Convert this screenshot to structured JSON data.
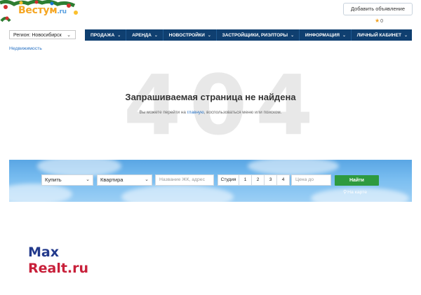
{
  "header": {
    "logo_text": "Вестум",
    "logo_suffix": ".ru",
    "add_ad_label": "Добавить объявление",
    "favorites_count": "0"
  },
  "nav": {
    "region_label": "Регион: Новосибирск",
    "items": [
      {
        "label": "ПРОДАЖА"
      },
      {
        "label": "АРЕНДА"
      },
      {
        "label": "НОВОСТРОЙКИ"
      },
      {
        "label": "ЗАСТРОЙЩИКИ, РИЭЛТОРЫ"
      },
      {
        "label": "ИНФОРМАЦИЯ"
      },
      {
        "label": "ЛИЧНЫЙ КАБИНЕТ"
      }
    ]
  },
  "breadcrumb": "Недвижимость",
  "error": {
    "code": "404",
    "title": "Запрашиваемая страница не найдена",
    "sub_before": "Вы можете перейти на ",
    "sub_link": "главную",
    "sub_after": ", воспользоваться меню или поиском."
  },
  "search": {
    "deal_value": "Купить",
    "type_value": "Квартира",
    "address_placeholder": "Название ЖК, адрес",
    "rooms": [
      "Студия",
      "1",
      "2",
      "3",
      "4"
    ],
    "price_placeholder": "Цена до",
    "find_label": "Найти",
    "map_label": "На карте"
  },
  "watermark": {
    "line1": "Max",
    "line2": "Realt.ru"
  },
  "colors": {
    "nav_bg": "#0f3f70",
    "link": "#2a73c4",
    "find_button": "#2e9a3f",
    "watermark_blue": "#233a8c",
    "watermark_red": "#c8203a"
  }
}
